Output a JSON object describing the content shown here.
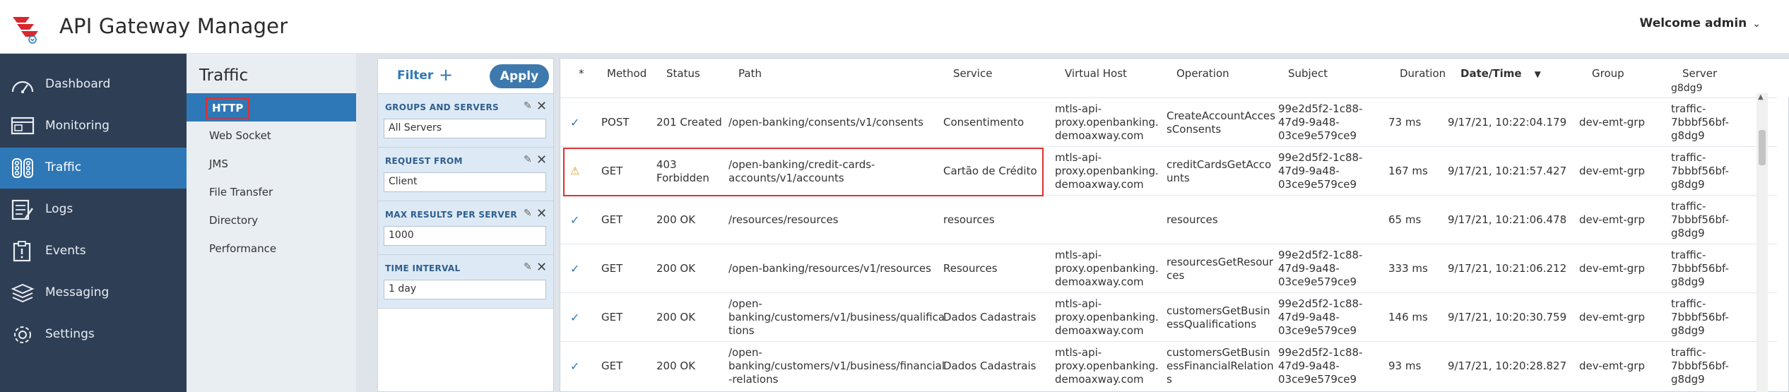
{
  "header": {
    "title": "API Gateway Manager",
    "welcome": "Welcome admin"
  },
  "nav": {
    "items": [
      {
        "label": "Dashboard",
        "icon": "dashboard-gauge-icon"
      },
      {
        "label": "Monitoring",
        "icon": "monitor-icon"
      },
      {
        "label": "Traffic",
        "icon": "traffic-icon"
      },
      {
        "label": "Logs",
        "icon": "logs-icon"
      },
      {
        "label": "Events",
        "icon": "events-icon"
      },
      {
        "label": "Messaging",
        "icon": "messaging-stack-icon"
      },
      {
        "label": "Settings",
        "icon": "gear-icon"
      }
    ],
    "active": "Traffic"
  },
  "subnav": {
    "title": "Traffic",
    "items": [
      "HTTP",
      "Web Socket",
      "JMS",
      "File Transfer",
      "Directory",
      "Performance"
    ],
    "active": "HTTP"
  },
  "filter": {
    "title": "Filter",
    "apply_label": "Apply",
    "groups": [
      {
        "label": "GROUPS AND SERVERS",
        "value": "All Servers"
      },
      {
        "label": "REQUEST FROM",
        "value": "Client"
      },
      {
        "label": "MAX RESULTS PER SERVER",
        "value": "1000"
      },
      {
        "label": "TIME INTERVAL",
        "value": "1 day"
      }
    ]
  },
  "table": {
    "columns": [
      "*",
      "Method",
      "Status",
      "Path",
      "Service",
      "Virtual Host",
      "Operation",
      "Subject",
      "Duration",
      "Date/Time",
      "Group",
      "Server"
    ],
    "sorted_column": "Date/Time",
    "partial_top_server": "g8dg9",
    "rows": [
      {
        "flag": "ok",
        "method": "POST",
        "status": [
          "201 Created"
        ],
        "path": [
          "/open-banking/consents/v1/consents"
        ],
        "service": "Consentimento",
        "vhost": [
          "mtls-api-",
          "proxy.openbanking.",
          "demoaxway.com"
        ],
        "operation": [
          "CreateAccountAcces",
          "sConsents"
        ],
        "subject": [
          "99e2d5f2-1c88-",
          "47d9-9a48-",
          "03ce9e579ce9"
        ],
        "duration": "73 ms",
        "datetime": "9/17/21, 10:22:04.179",
        "group": "dev-emt-grp",
        "server": [
          "traffic-",
          "7bbbf56bf-",
          "g8dg9"
        ]
      },
      {
        "flag": "warn",
        "method": "GET",
        "status": [
          "403",
          "Forbidden"
        ],
        "path": [
          "/open-banking/credit-cards-",
          "accounts/v1/accounts"
        ],
        "service": "Cartão de Crédito",
        "vhost": [
          "mtls-api-",
          "proxy.openbanking.",
          "demoaxway.com"
        ],
        "operation": [
          "creditCardsGetAcco",
          "unts"
        ],
        "subject": [
          "99e2d5f2-1c88-",
          "47d9-9a48-",
          "03ce9e579ce9"
        ],
        "duration": "167 ms",
        "datetime": "9/17/21, 10:21:57.427",
        "group": "dev-emt-grp",
        "server": [
          "traffic-",
          "7bbbf56bf-",
          "g8dg9"
        ]
      },
      {
        "flag": "ok",
        "method": "GET",
        "status": [
          "200 OK"
        ],
        "path": [
          "/resources/resources"
        ],
        "service": "resources",
        "vhost": [],
        "operation": [
          "resources"
        ],
        "subject": [],
        "duration": "65 ms",
        "datetime": "9/17/21, 10:21:06.478",
        "group": "dev-emt-grp",
        "server": [
          "traffic-",
          "7bbbf56bf-",
          "g8dg9"
        ]
      },
      {
        "flag": "ok",
        "method": "GET",
        "status": [
          "200 OK"
        ],
        "path": [
          "/open-banking/resources/v1/resources"
        ],
        "service": "Resources",
        "vhost": [
          "mtls-api-",
          "proxy.openbanking.",
          "demoaxway.com"
        ],
        "operation": [
          "resourcesGetResour",
          "ces"
        ],
        "subject": [
          "99e2d5f2-1c88-",
          "47d9-9a48-",
          "03ce9e579ce9"
        ],
        "duration": "333 ms",
        "datetime": "9/17/21, 10:21:06.212",
        "group": "dev-emt-grp",
        "server": [
          "traffic-",
          "7bbbf56bf-",
          "g8dg9"
        ]
      },
      {
        "flag": "ok",
        "method": "GET",
        "status": [
          "200 OK"
        ],
        "path": [
          "/open-",
          "banking/customers/v1/business/qualifica",
          "tions"
        ],
        "service": "Dados Cadastrais",
        "vhost": [
          "mtls-api-",
          "proxy.openbanking.",
          "demoaxway.com"
        ],
        "operation": [
          "customersGetBusin",
          "essQualifications"
        ],
        "subject": [
          "99e2d5f2-1c88-",
          "47d9-9a48-",
          "03ce9e579ce9"
        ],
        "duration": "146 ms",
        "datetime": "9/17/21, 10:20:30.759",
        "group": "dev-emt-grp",
        "server": [
          "traffic-",
          "7bbbf56bf-",
          "g8dg9"
        ]
      },
      {
        "flag": "ok",
        "method": "GET",
        "status": [
          "200 OK"
        ],
        "path": [
          "/open-",
          "banking/customers/v1/business/financial",
          "-relations"
        ],
        "service": "Dados Cadastrais",
        "vhost": [
          "mtls-api-",
          "proxy.openbanking.",
          "demoaxway.com"
        ],
        "operation": [
          "customersGetBusin",
          "essFinancialRelation",
          "s"
        ],
        "subject": [
          "99e2d5f2-1c88-",
          "47d9-9a48-",
          "03ce9e579ce9"
        ],
        "duration": "93 ms",
        "datetime": "9/17/21, 10:20:28.827",
        "group": "dev-emt-grp",
        "server": [
          "traffic-",
          "7bbbf56bf-",
          "g8dg9"
        ]
      }
    ]
  },
  "colors": {
    "accent": "#2f78b7",
    "nav_bg": "#2e3e55",
    "highlight": "#e03030",
    "warning": "#d69a1a"
  }
}
